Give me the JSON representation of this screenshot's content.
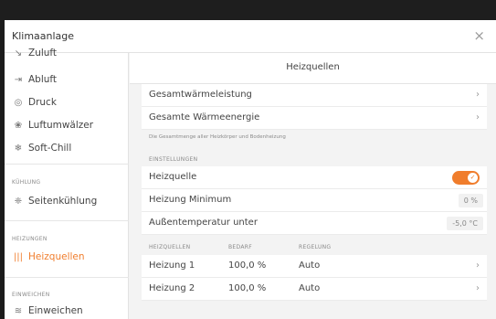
{
  "window": {
    "dialog_title": "Klimaanlage",
    "close_glyph": "×"
  },
  "sidebar": {
    "items": [
      {
        "icon": "zuluft-icon",
        "glyph": "↘",
        "label": "Zuluft"
      },
      {
        "icon": "abluft-icon",
        "glyph": "⇥",
        "label": "Abluft"
      },
      {
        "icon": "druck-icon",
        "glyph": "◎",
        "label": "Druck"
      },
      {
        "icon": "luftumwaelzer-icon",
        "glyph": "❀",
        "label": "Luftumwälzer"
      },
      {
        "icon": "soft-chill-icon",
        "glyph": "❄",
        "label": "Soft-Chill"
      }
    ],
    "sections": {
      "kuehlung": {
        "title": "KÜHLUNG",
        "items": [
          {
            "icon": "seitenkuehlung-icon",
            "glyph": "❈",
            "label": "Seitenkühlung"
          }
        ]
      },
      "heizungen": {
        "title": "HEIZUNGEN",
        "items": [
          {
            "icon": "heizquellen-icon",
            "glyph": "|||",
            "label": "Heizquellen",
            "active": true
          }
        ]
      },
      "einweichen": {
        "title": "EINWEICHEN",
        "items": [
          {
            "icon": "einweichen-icon",
            "glyph": "≋",
            "label": "Einweichen"
          }
        ]
      }
    }
  },
  "main": {
    "title": "Heizquellen",
    "rows": [
      {
        "label": "Gesamtwärmeleistung",
        "chevron": "›"
      },
      {
        "label": "Gesamte Wärmeenergie",
        "chevron": "›"
      }
    ],
    "note": "Die Gesamtmenge aller Heizkörper und Bodenheizung",
    "settings": {
      "title": "EINSTELLUNGEN",
      "heizquelle_label": "Heizquelle",
      "heizquelle_on": true,
      "toggle_glyph": "✓",
      "minimum_label": "Heizung Minimum",
      "minimum_value": "0 %",
      "aussentemp_label": "Außentemperatur unter",
      "aussentemp_value": "-5,0 °C"
    },
    "table": {
      "headers": [
        "HEIZQUELLEN",
        "BEDARF",
        "REGELUNG"
      ],
      "rows": [
        {
          "name": "Heizung 1",
          "bedarf": "100,0 %",
          "regelung": "Auto",
          "chevron": "›"
        },
        {
          "name": "Heizung 2",
          "bedarf": "100,0 %",
          "regelung": "Auto",
          "chevron": "›"
        }
      ]
    }
  },
  "colors": {
    "accent": "#f07d2c",
    "background": "#f3f3f3",
    "panel": "#ffffff"
  }
}
